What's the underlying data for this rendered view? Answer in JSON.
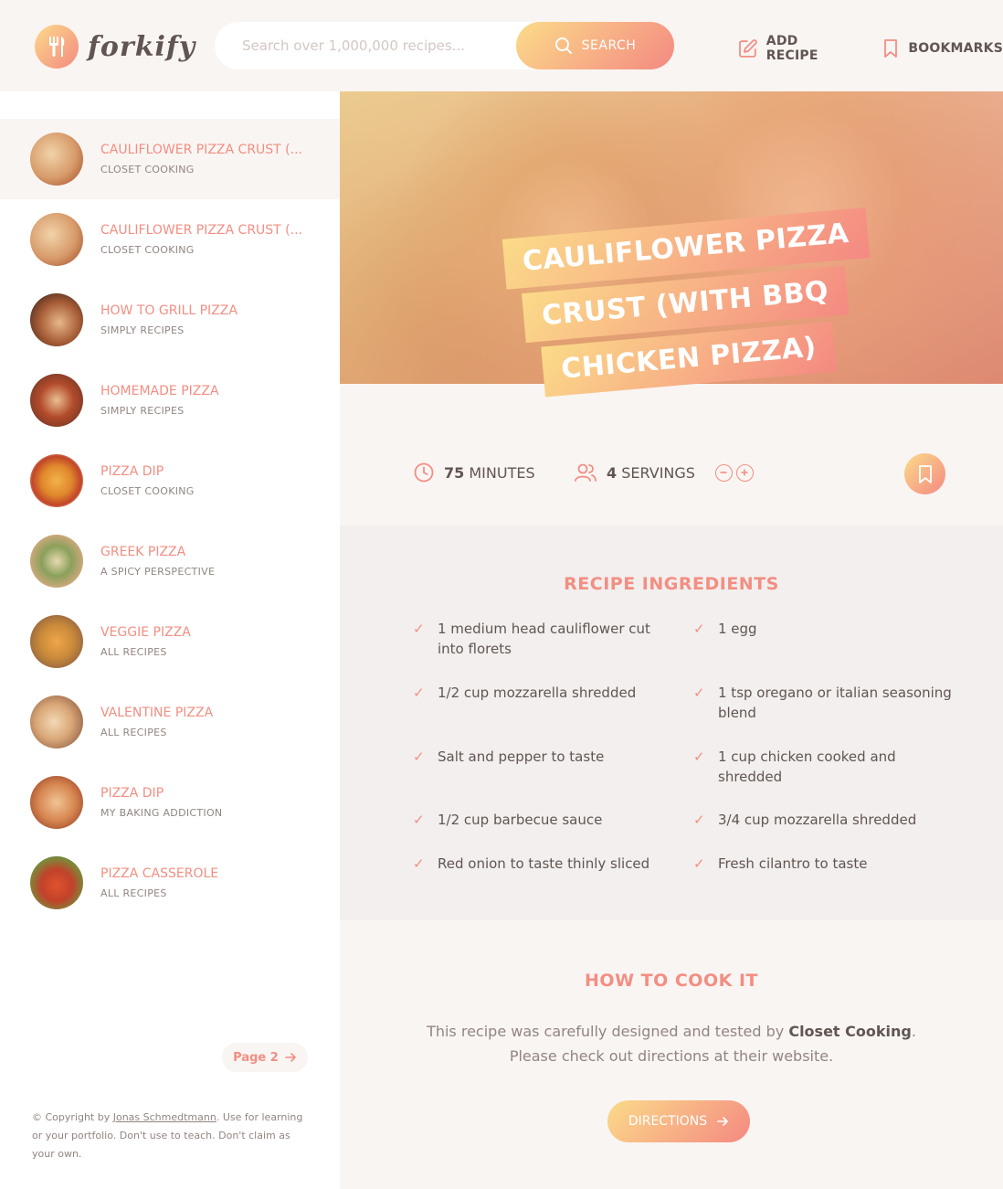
{
  "app": {
    "logo_text": "forkify"
  },
  "search": {
    "placeholder": "Search over 1,000,000 recipes...",
    "button_label": "SEARCH"
  },
  "nav": {
    "add_recipe": "ADD RECIPE",
    "bookmarks": "BOOKMARKS"
  },
  "results": [
    {
      "title": "CAULIFLOWER PIZZA CRUST (...",
      "publisher": "CLOSET COOKING"
    },
    {
      "title": "CAULIFLOWER PIZZA CRUST (...",
      "publisher": "CLOSET COOKING"
    },
    {
      "title": "HOW TO GRILL PIZZA",
      "publisher": "SIMPLY RECIPES"
    },
    {
      "title": "HOMEMADE PIZZA",
      "publisher": "SIMPLY RECIPES"
    },
    {
      "title": "PIZZA DIP",
      "publisher": "CLOSET COOKING"
    },
    {
      "title": "GREEK PIZZA",
      "publisher": "A SPICY PERSPECTIVE"
    },
    {
      "title": "VEGGIE PIZZA",
      "publisher": "ALL RECIPES"
    },
    {
      "title": "VALENTINE PIZZA",
      "publisher": "ALL RECIPES"
    },
    {
      "title": "PIZZA DIP",
      "publisher": "MY BAKING ADDICTION"
    },
    {
      "title": "PIZZA CASSEROLE",
      "publisher": "ALL RECIPES"
    }
  ],
  "pagination": {
    "next_label": "Page 2"
  },
  "copyright": {
    "prefix": "© Copyright by ",
    "author": "Jonas Schmedtmann",
    "suffix": ". Use for learning or your portfolio. Don't use to teach. Don't claim as your own."
  },
  "recipe": {
    "title_lines": [
      "CAULIFLOWER PIZZA",
      "CRUST (WITH BBQ",
      "CHICKEN PIZZA)"
    ],
    "minutes": "75",
    "minutes_label": "MINUTES",
    "servings": "4",
    "servings_label": "SERVINGS",
    "ingredients_heading": "RECIPE INGREDIENTS",
    "ingredients": [
      "1 medium head cauliflower cut into florets",
      "1 egg",
      "1/2 cup mozzarella shredded",
      "1 tsp oregano or italian seasoning blend",
      "Salt and pepper to taste",
      "1 cup chicken cooked and shredded",
      "1/2 cup barbecue sauce",
      "3/4 cup mozzarella shredded",
      "Red onion to taste thinly sliced",
      "Fresh cilantro to taste"
    ],
    "cook_heading": "HOW TO COOK IT",
    "cook_text_prefix": "This recipe was carefully designed and tested by ",
    "publisher": "Closet Cooking",
    "cook_text_suffix_1": ".",
    "cook_text_line2": "Please check out directions at their website.",
    "directions_label": "DIRECTIONS"
  },
  "colors": {
    "accent_start": "#fbdb89",
    "accent_end": "#f48982",
    "accent_text": "#f38e82",
    "text": "#615551"
  }
}
